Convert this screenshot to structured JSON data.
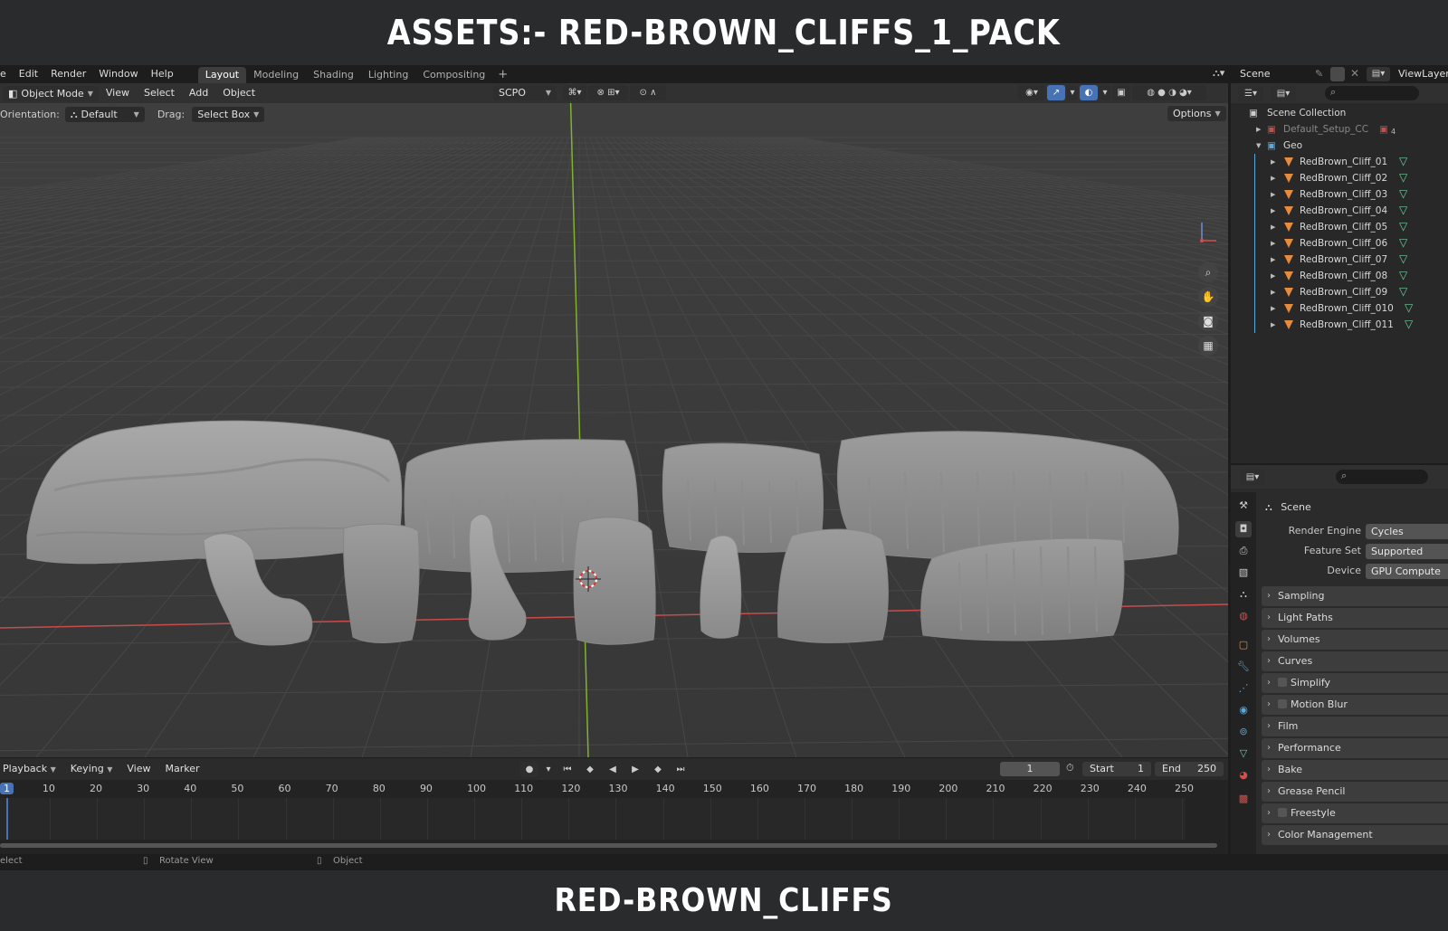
{
  "banner_top": "ASSETS:- RED-BROWN_CLIFFS_1_PACK",
  "banner_bottom": "RED-BROWN_CLIFFS",
  "menu": [
    "e",
    "Edit",
    "Render",
    "Window",
    "Help"
  ],
  "workspaces": [
    "Layout",
    "Modeling",
    "Shading",
    "Lighting",
    "Compositing"
  ],
  "workspace_add": "+",
  "scene_name": "Scene",
  "view_layer": "ViewLayer",
  "viewport": {
    "mode": "Object Mode",
    "menus": [
      "View",
      "Select",
      "Add",
      "Object"
    ],
    "transform": "SCPO",
    "orientation_label": "Orientation:",
    "orientation_value": "Default",
    "drag_label": "Drag:",
    "drag_value": "Select Box",
    "options": "Options"
  },
  "timeline": {
    "menus": [
      "Playback",
      "Keying",
      "View",
      "Marker"
    ],
    "current_frame": "1",
    "start_label": "Start",
    "start": "1",
    "end_label": "End",
    "end": "250",
    "ticks": [
      "1",
      "10",
      "20",
      "30",
      "40",
      "50",
      "60",
      "70",
      "80",
      "90",
      "100",
      "110",
      "120",
      "130",
      "140",
      "150",
      "160",
      "170",
      "180",
      "190",
      "200",
      "210",
      "220",
      "230",
      "240",
      "250"
    ]
  },
  "status": {
    "left": "elect",
    "middle": "Rotate View",
    "right": "Object"
  },
  "outliner": {
    "root": "Scene Collection",
    "default_collection": "Default_Setup_CC",
    "default_count": "4",
    "geo_collection": "Geo",
    "objects": [
      "RedBrown_Cliff_01",
      "RedBrown_Cliff_02",
      "RedBrown_Cliff_03",
      "RedBrown_Cliff_04",
      "RedBrown_Cliff_05",
      "RedBrown_Cliff_06",
      "RedBrown_Cliff_07",
      "RedBrown_Cliff_08",
      "RedBrown_Cliff_09",
      "RedBrown_Cliff_010",
      "RedBrown_Cliff_011"
    ]
  },
  "properties": {
    "context": "Scene",
    "render_engine_label": "Render Engine",
    "render_engine": "Cycles",
    "feature_set_label": "Feature Set",
    "feature_set": "Supported",
    "device_label": "Device",
    "device": "GPU Compute",
    "panels": [
      {
        "label": "Sampling",
        "checkbox": false
      },
      {
        "label": "Light Paths",
        "checkbox": false
      },
      {
        "label": "Volumes",
        "checkbox": false
      },
      {
        "label": "Curves",
        "checkbox": false
      },
      {
        "label": "Simplify",
        "checkbox": true
      },
      {
        "label": "Motion Blur",
        "checkbox": true
      },
      {
        "label": "Film",
        "checkbox": false
      },
      {
        "label": "Performance",
        "checkbox": false
      },
      {
        "label": "Bake",
        "checkbox": false
      },
      {
        "label": "Grease Pencil",
        "checkbox": false
      },
      {
        "label": "Freestyle",
        "checkbox": true
      },
      {
        "label": "Color Management",
        "checkbox": false
      }
    ]
  },
  "colors": {
    "accent_blue": "#4772b3",
    "mesh_orange": "#e58c3c",
    "mesh_data_green": "#6ed09a",
    "x_axis": "#c94b4b",
    "y_axis": "#7fb32c"
  }
}
